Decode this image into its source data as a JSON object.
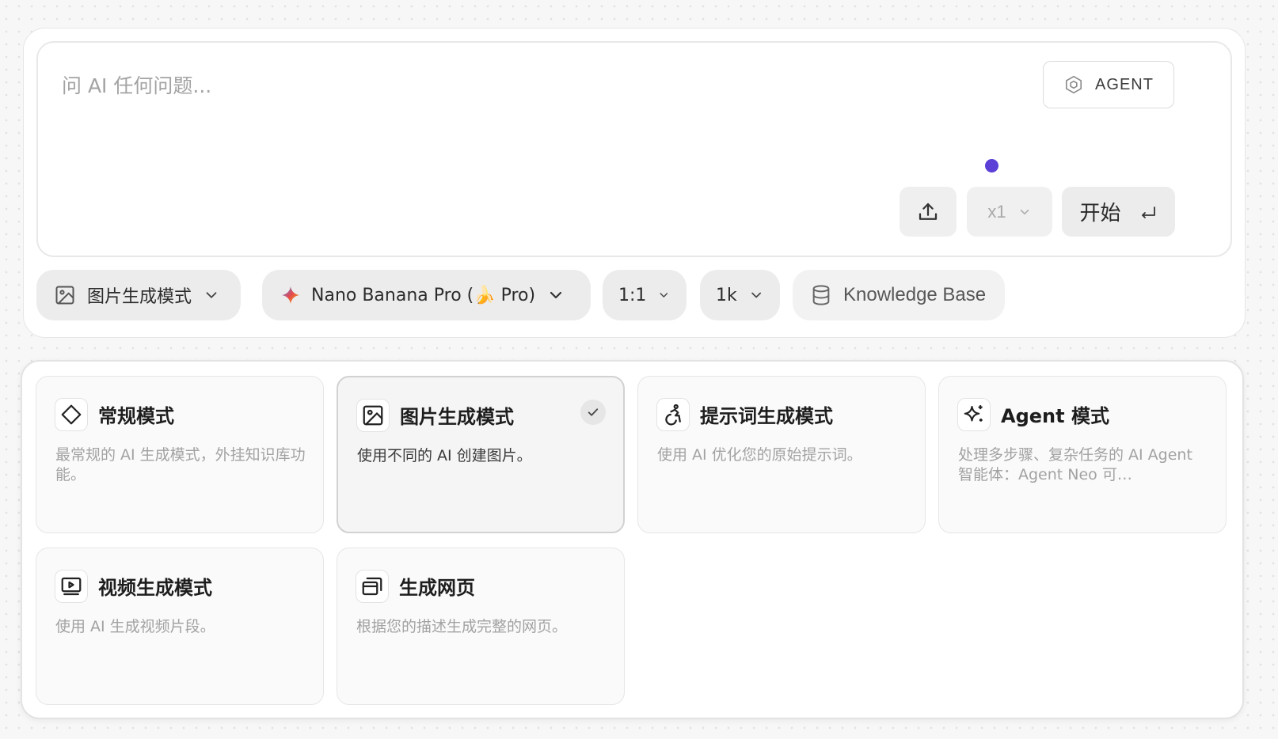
{
  "prompt": {
    "placeholder": "问 AI 任何问题...",
    "value": ""
  },
  "agent_button": {
    "label": "AGENT",
    "icon": "agent-cube-icon"
  },
  "actions": {
    "upload_icon": "upload-icon",
    "count_value": "x1",
    "start_label": "开始",
    "enter_icon": "enter-key-icon"
  },
  "options_bar": {
    "mode": {
      "label": "图片生成模式",
      "icon": "image-icon"
    },
    "model": {
      "label": "Nano Banana Pro (🍌 Pro)",
      "icon": "gemini-sparkle-icon"
    },
    "ratio": {
      "label": "1:1"
    },
    "resolution": {
      "label": "1k"
    },
    "knowledge_base": {
      "label": "Knowledge Base",
      "icon": "database-icon"
    }
  },
  "modes": [
    {
      "title": "常规模式",
      "description": "最常规的 AI 生成模式，外挂知识库功能。",
      "icon": "diamond-icon",
      "selected": false
    },
    {
      "title": "图片生成模式",
      "description": "使用不同的 AI 创建图片。",
      "icon": "image-icon",
      "selected": true
    },
    {
      "title": "提示词生成模式",
      "description": "使用 AI 优化您的原始提示词。",
      "icon": "accessibility-icon",
      "selected": false
    },
    {
      "title": "Agent 模式",
      "description": "处理多步骤、复杂任务的 AI Agent 智能体：Agent Neo 可…",
      "icon": "sparkles-icon",
      "selected": false
    },
    {
      "title": "视频生成模式",
      "description": "使用 AI 生成视频片段。",
      "icon": "video-icon",
      "selected": false
    },
    {
      "title": "生成网页",
      "description": "根据您的描述生成完整的网页。",
      "icon": "windows-icon",
      "selected": false
    }
  ],
  "colors": {
    "accent_dot": "#5b3fd6",
    "pill_background": "#ececec",
    "selected_card_border": "#d2d2d2"
  }
}
